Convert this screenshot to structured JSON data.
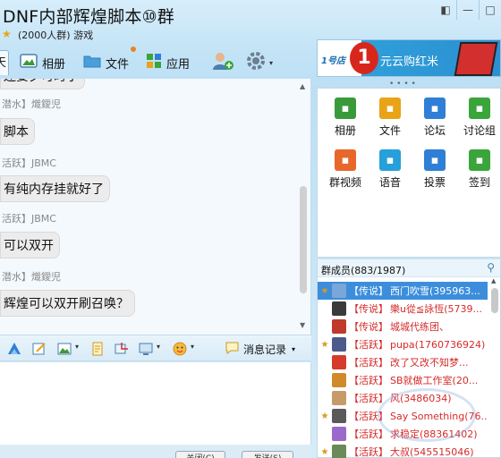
{
  "title": {
    "name": "DNF内部辉煌脚本⑩群",
    "member_count_label": "(2000人群)",
    "category": "游戏"
  },
  "toolbar": {
    "tab_partial": "天",
    "items": [
      {
        "label": "相册",
        "icon": "album-icon"
      },
      {
        "label": "文件",
        "icon": "folder-icon"
      },
      {
        "label": "应用",
        "icon": "apps-icon"
      }
    ]
  },
  "ad": {
    "brand": "1号店",
    "price": "1",
    "text": "元云购红米"
  },
  "chat": {
    "messages": [
      {
        "header": "",
        "text": "还要夕可时小"
      },
      {
        "header": "潜水】熾鑀児",
        "text": "脚本"
      },
      {
        "header": "活跃】JBMC",
        "text": "有纯内存挂就好了"
      },
      {
        "header": "活跃】JBMC",
        "text": "可以双开"
      },
      {
        "header": "潜水】熾鑀児",
        "text": "辉煌可以双开刷召唤？"
      }
    ]
  },
  "input_bar": {
    "history_label": "消息记录"
  },
  "bottom_buttons": [
    "关闭(C)",
    "发送(S)"
  ],
  "apps": [
    {
      "label": "相册",
      "color": "#3a9a3a",
      "icon": "album-icon"
    },
    {
      "label": "文件",
      "color": "#e8a317",
      "icon": "folder-icon"
    },
    {
      "label": "论坛",
      "color": "#2f7fd6",
      "icon": "forum-icon"
    },
    {
      "label": "讨论组",
      "color": "#3aa53a",
      "icon": "discussion-icon"
    },
    {
      "label": "群视频",
      "color": "#e8672a",
      "icon": "video-icon"
    },
    {
      "label": "语音",
      "color": "#26a0d9",
      "icon": "voice-icon"
    },
    {
      "label": "投票",
      "color": "#2f7fd6",
      "icon": "vote-icon"
    },
    {
      "label": "签到",
      "color": "#3aa53a",
      "icon": "checkin-icon"
    }
  ],
  "members": {
    "header": "群成员(883/1987)",
    "list": [
      {
        "tag": "【传说】",
        "name": "西门吹雪(395963...",
        "selected": true,
        "star": true,
        "avatar": "#7aa7d8"
      },
      {
        "tag": "【传说】",
        "name": "樂u從≦詠恆(5739...",
        "selected": false,
        "star": false,
        "avatar": "#3a3a3a"
      },
      {
        "tag": "【传说】",
        "name": "城城代练团、",
        "selected": false,
        "star": false,
        "avatar": "#c0392b"
      },
      {
        "tag": "【活跃】",
        "name": "pupa(1760736924)",
        "selected": false,
        "star": true,
        "avatar": "#4a5a8a"
      },
      {
        "tag": "【活跃】",
        "name": "改了又改不知梦...",
        "selected": false,
        "star": false,
        "avatar": "#d63a2a"
      },
      {
        "tag": "【活跃】",
        "name": "SB就做工作室(20...",
        "selected": false,
        "star": false,
        "avatar": "#d08a2a"
      },
      {
        "tag": "【活跃】",
        "name": "风(3486034)",
        "selected": false,
        "star": false,
        "avatar": "#c79a6a"
      },
      {
        "tag": "【活跃】",
        "name": "Say Something(76...",
        "selected": false,
        "star": true,
        "avatar": "#5a5a5a"
      },
      {
        "tag": "【活跃】",
        "name": "求稳定(88361402)",
        "selected": false,
        "star": false,
        "avatar": "#9a6acb"
      },
      {
        "tag": "【活跃】",
        "name": "大叔(545515046)",
        "selected": false,
        "star": true,
        "avatar": "#6a8a5a"
      }
    ]
  }
}
